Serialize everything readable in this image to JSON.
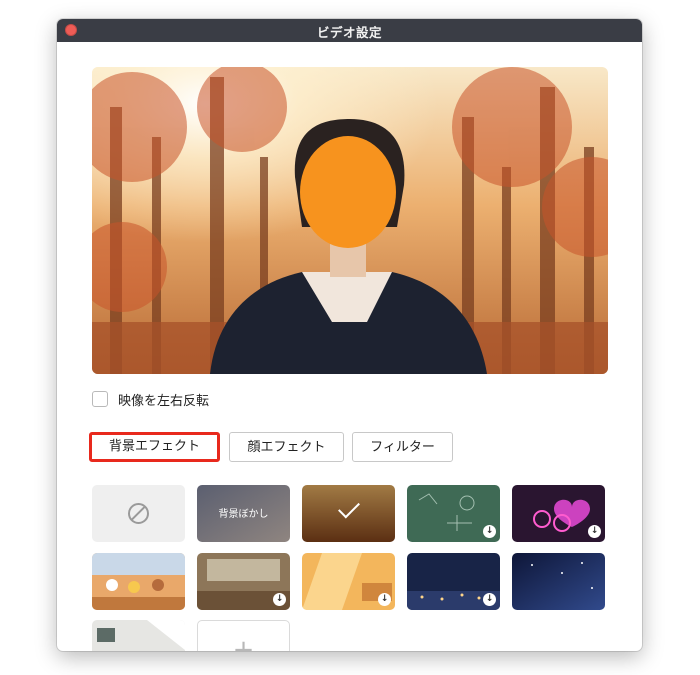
{
  "window": {
    "title": "ビデオ設定"
  },
  "options": {
    "mirror_label": "映像を左右反転",
    "mirror_checked": false
  },
  "tabs": [
    {
      "label": "背景エフェクト",
      "active": true
    },
    {
      "label": "顔エフェクト",
      "active": false
    },
    {
      "label": "フィルター",
      "active": false
    }
  ],
  "backgrounds": {
    "blur_label": "背景ぼかし",
    "add_symbol": "+",
    "download_symbol": "↓",
    "items": [
      {
        "name": "none",
        "selected": false
      },
      {
        "name": "背景ぼかし",
        "selected": false
      },
      {
        "name": "autumn-forest",
        "selected": true
      },
      {
        "name": "chalkboard",
        "download": true
      },
      {
        "name": "neon-hearts",
        "download": true
      },
      {
        "name": "characters-garden",
        "download": false
      },
      {
        "name": "classroom",
        "download": true
      },
      {
        "name": "sunny-room",
        "download": true
      },
      {
        "name": "night-city",
        "download": true
      },
      {
        "name": "starry-sky",
        "download": false
      },
      {
        "name": "studio-room",
        "download": false
      },
      {
        "name": "add",
        "download": false
      }
    ]
  },
  "colors": {
    "accent": "#e8291d",
    "titlebar": "#3a3d45",
    "close": "#ee5c56"
  }
}
